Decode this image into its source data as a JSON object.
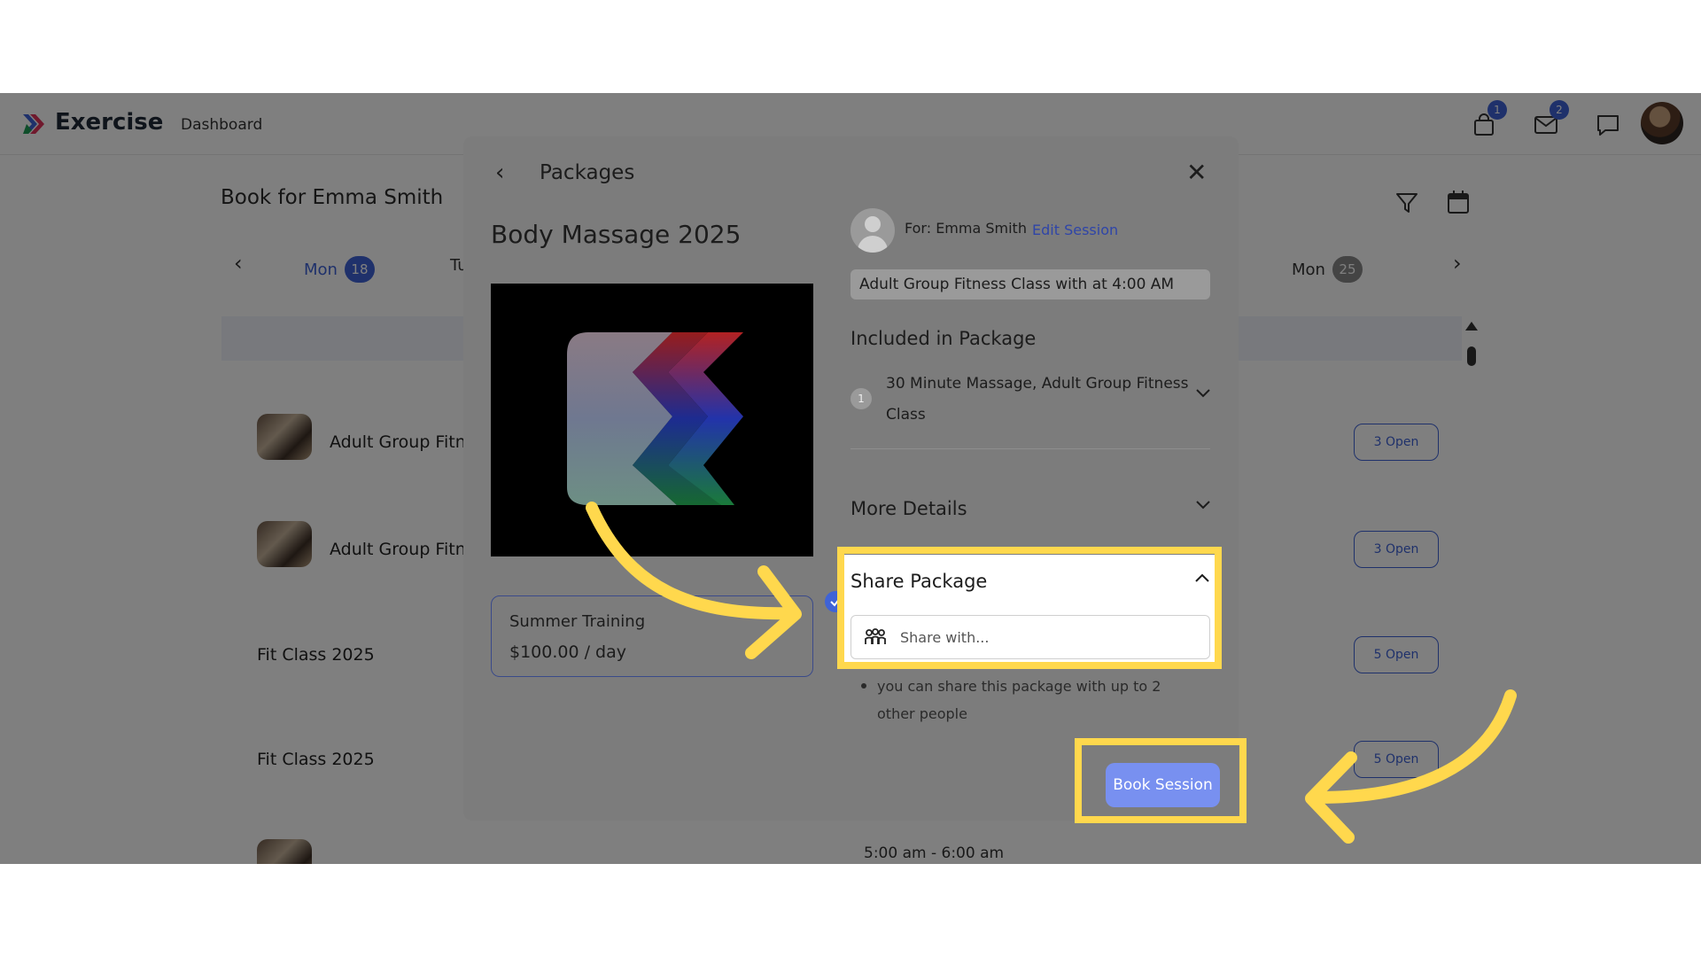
{
  "app": {
    "brand": "Exercise",
    "nav_dashboard": "Dashboard",
    "cart_badge": "1",
    "mail_badge": "2"
  },
  "page": {
    "title": "Book for Emma Smith",
    "days": [
      {
        "label": "Mon",
        "num": "18"
      },
      {
        "label": "Tu"
      },
      {
        "label": "Mon",
        "num": "25"
      }
    ],
    "rows": [
      {
        "title": "Adult Group Fitne",
        "open": "3 Open"
      },
      {
        "title": "Adult Group Fitne",
        "open": "3 Open"
      },
      {
        "title": "Fit Class 2025",
        "open": "5 Open"
      },
      {
        "title": "Fit Class 2025",
        "open": "5 Open"
      }
    ],
    "partial_time": "5:00 am - 6:00 am"
  },
  "modal": {
    "title": "Packages",
    "package_name": "Body Massage 2025",
    "option": {
      "name": "Summer Training",
      "price": "$100.00 / day"
    },
    "for_label": "For: Emma Smith",
    "edit_session": "Edit Session",
    "session_chip": "Adult Group Fitness Class with at 4:00 AM",
    "included_title": "Included in Package",
    "included_count": "1",
    "included_item": "30 Minute Massage, Adult Group Fitness Class",
    "more_details": "More Details",
    "share_title": "Share Package",
    "share_placeholder": "Share with...",
    "share_hint": "you can share this package with up to 2 other people",
    "book_button": "Book Session"
  },
  "colors": {
    "accent": "#3f63d6",
    "highlight": "#ffd84d",
    "button": "#7890f0"
  }
}
